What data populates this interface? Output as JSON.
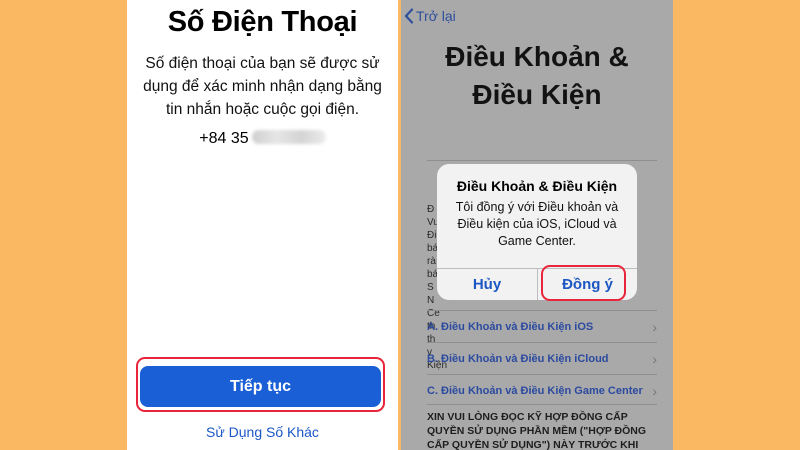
{
  "left_screen": {
    "title": "Số Điện Thoại",
    "description": "Số điện thoại của bạn sẽ được sử dụng để xác minh nhận dạng bằng tin nhắn hoặc cuộc gọi điện.",
    "phone_prefix": "+84 35",
    "continue_button": "Tiếp tục",
    "other_number_link": "Sử Dụng Số Khác"
  },
  "right_screen": {
    "back_label": "Trở lại",
    "title_line1": "Điều Khoản &",
    "title_line2": "Điều Kiện",
    "partial_text": [
      "Đ",
      "Vu",
      "Đi",
      "bá",
      "rà",
      "bá",
      "S",
      "N",
      "Ce",
      "th",
      "th",
      "v",
      "Kiện"
    ],
    "links": [
      "A. Điều Khoản và Điều Kiện iOS",
      "B. Điều Khoản và Điều Kiện iCloud",
      "C. Điều Khoản và Điều Kiện Game Center"
    ],
    "bottom_text": "XIN VUI LÒNG ĐỌC KỸ HỢP ĐỒNG CẤP QUYỀN SỬ DỤNG PHẦN MỀM (\"HỢP ĐỒNG CẤP QUYỀN SỬ DỤNG\") NÀY TRƯỚC KHI"
  },
  "alert": {
    "title": "Điều Khoản & Điều Kiện",
    "message": "Tôi đồng ý với Điều khoản và Điều kiện của iOS, iCloud và Game Center.",
    "cancel": "Hủy",
    "agree": "Đồng ý"
  },
  "colors": {
    "background": "#fbb862",
    "primary_blue": "#1a5fd6",
    "highlight_red": "#e8253a"
  }
}
